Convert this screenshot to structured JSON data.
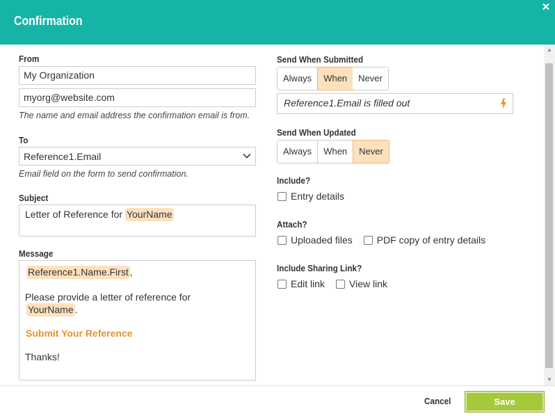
{
  "dialog": {
    "title": "Confirmation"
  },
  "from": {
    "label": "From",
    "name_value": "My Organization",
    "email_value": "myorg@website.com",
    "hint": "The name and email address the confirmation email is from."
  },
  "to": {
    "label": "To",
    "selected": "Reference1.Email",
    "hint": "Email field on the form to send confirmation."
  },
  "subject": {
    "label": "Subject",
    "prefix": "Letter of Reference for",
    "token": "YourName"
  },
  "message": {
    "label": "Message",
    "greeting_token": "Reference1.Name.First",
    "greeting_suffix": ",",
    "line1": "Please provide a letter of reference for",
    "line2_token": "YourName",
    "line2_suffix": ".",
    "link": "Submit Your Reference",
    "closing": "Thanks!"
  },
  "send_when_submitted": {
    "label": "Send When Submitted",
    "options": [
      "Always",
      "When",
      "Never"
    ],
    "selected": "When",
    "condition": "Reference1.Email is filled out"
  },
  "send_when_updated": {
    "label": "Send When Updated",
    "options": [
      "Always",
      "When",
      "Never"
    ],
    "selected": "Never"
  },
  "include": {
    "label": "Include?",
    "options": [
      {
        "label": "Entry details",
        "checked": false
      }
    ]
  },
  "attach": {
    "label": "Attach?",
    "options": [
      {
        "label": "Uploaded files",
        "checked": false
      },
      {
        "label": "PDF copy of entry details",
        "checked": false
      }
    ]
  },
  "sharing": {
    "label": "Include Sharing Link?",
    "options": [
      {
        "label": "Edit link",
        "checked": false
      },
      {
        "label": "View link",
        "checked": false
      }
    ]
  },
  "footer": {
    "cancel": "Cancel",
    "save": "Save"
  },
  "colors": {
    "header": "#16b3a7",
    "token": "#fde1bd",
    "link": "#e8922c",
    "save": "#a4c93a"
  }
}
